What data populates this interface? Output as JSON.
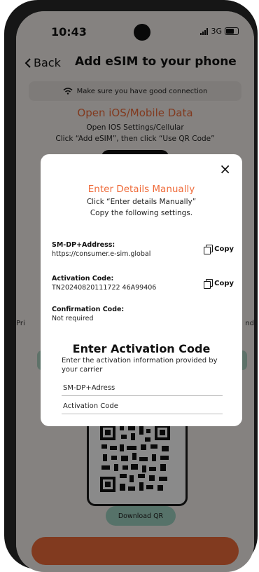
{
  "status_bar": {
    "time": "10:43",
    "network": "3G"
  },
  "header": {
    "back_label": "Back",
    "title": "Add eSIM to your phone"
  },
  "connection_banner": {
    "text": "Make sure you have good connection"
  },
  "ios_section": {
    "heading": "Open iOS/Mobile Data",
    "line1": "Open IOS Settings/Cellular",
    "line2": "Click “Add eSIM”, then click “Use QR Code”"
  },
  "background_text": {
    "left_fragment": "Pri",
    "right_fragment": "nd"
  },
  "download_button": {
    "label": "Download QR"
  },
  "modal": {
    "close_symbol": "×",
    "title": "Enter Details Manually",
    "line1": "Click “Enter details Manually”",
    "line2": "Copy the following settings.",
    "fields": [
      {
        "label": "SM-DP+Address:",
        "value": "https://consumer.e-sim.global",
        "copy_label": "Copy"
      },
      {
        "label": "Activation Code:",
        "value": "TN20240820111722 46A99406",
        "copy_label": "Copy"
      },
      {
        "label": "Confirmation Code:",
        "value": "Not required"
      }
    ],
    "activation": {
      "title": "Enter Activation Code",
      "description": "Enter the activation information provided by your carrier",
      "inputs": [
        {
          "placeholder": "SM-DP+Adress",
          "value": ""
        },
        {
          "placeholder": "Activation Code",
          "value": ""
        }
      ]
    }
  },
  "colors": {
    "accent": "#ef6b3a",
    "teal": "#9fd3c2",
    "background": "#f6f1ec"
  }
}
